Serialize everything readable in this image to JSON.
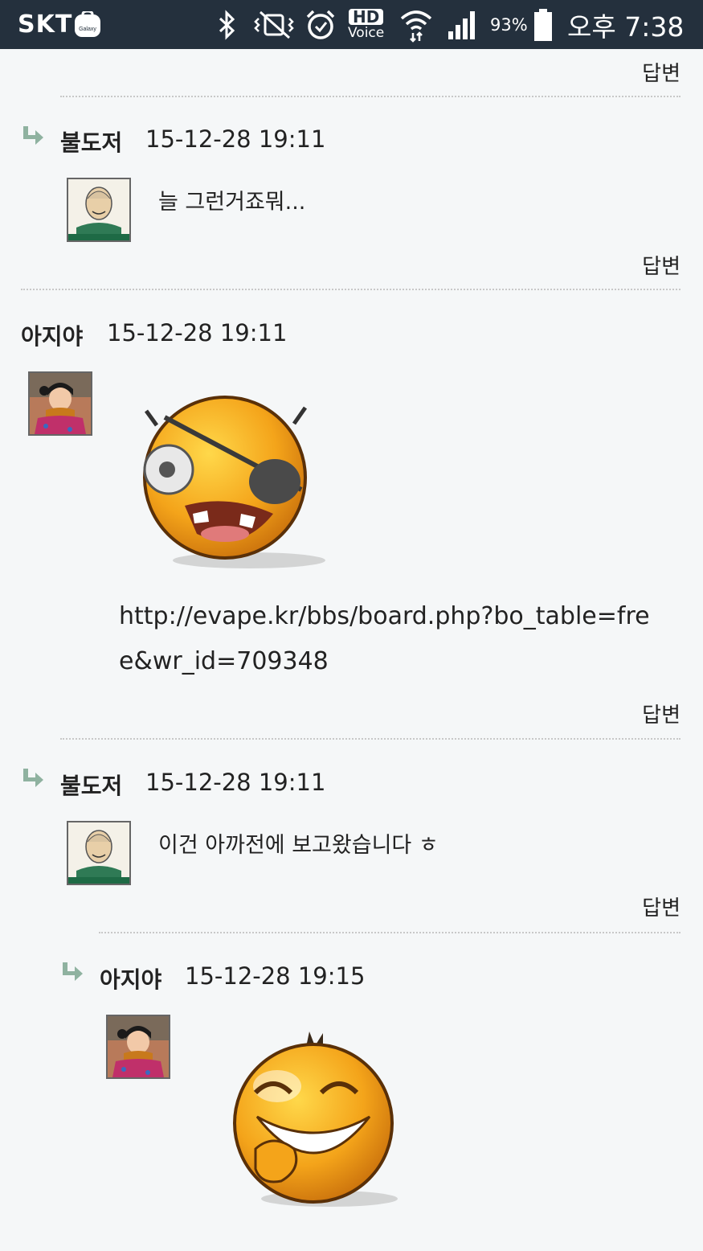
{
  "status_bar": {
    "carrier": "SKT",
    "galaxy_label": "Galaxy",
    "hd_label": "HD",
    "voice_label": "Voice",
    "battery": "93%",
    "time": "오후 7:38"
  },
  "top_reply": "답변",
  "comments": [
    {
      "name": "불도저",
      "time": "15-12-28 19:11",
      "text": "늘 그런거죠뭐...",
      "reply": "답변"
    },
    {
      "name": "아지야",
      "time": "15-12-28 19:11",
      "link": "http://evape.kr/bbs/board.php?bo_table=free&wr_id=709348",
      "reply": "답변"
    },
    {
      "name": "불도저",
      "time": "15-12-28 19:11",
      "text": "이건 아까전에 보고왔습니다 ㅎ",
      "reply": "답변"
    },
    {
      "name": "아지야",
      "time": "15-12-28 19:15"
    }
  ],
  "colors": {
    "status_bar": "#24303d",
    "background": "#f5f7f8",
    "reply_arrow": "#8fb2a0",
    "separator": "#c8c8c8"
  }
}
